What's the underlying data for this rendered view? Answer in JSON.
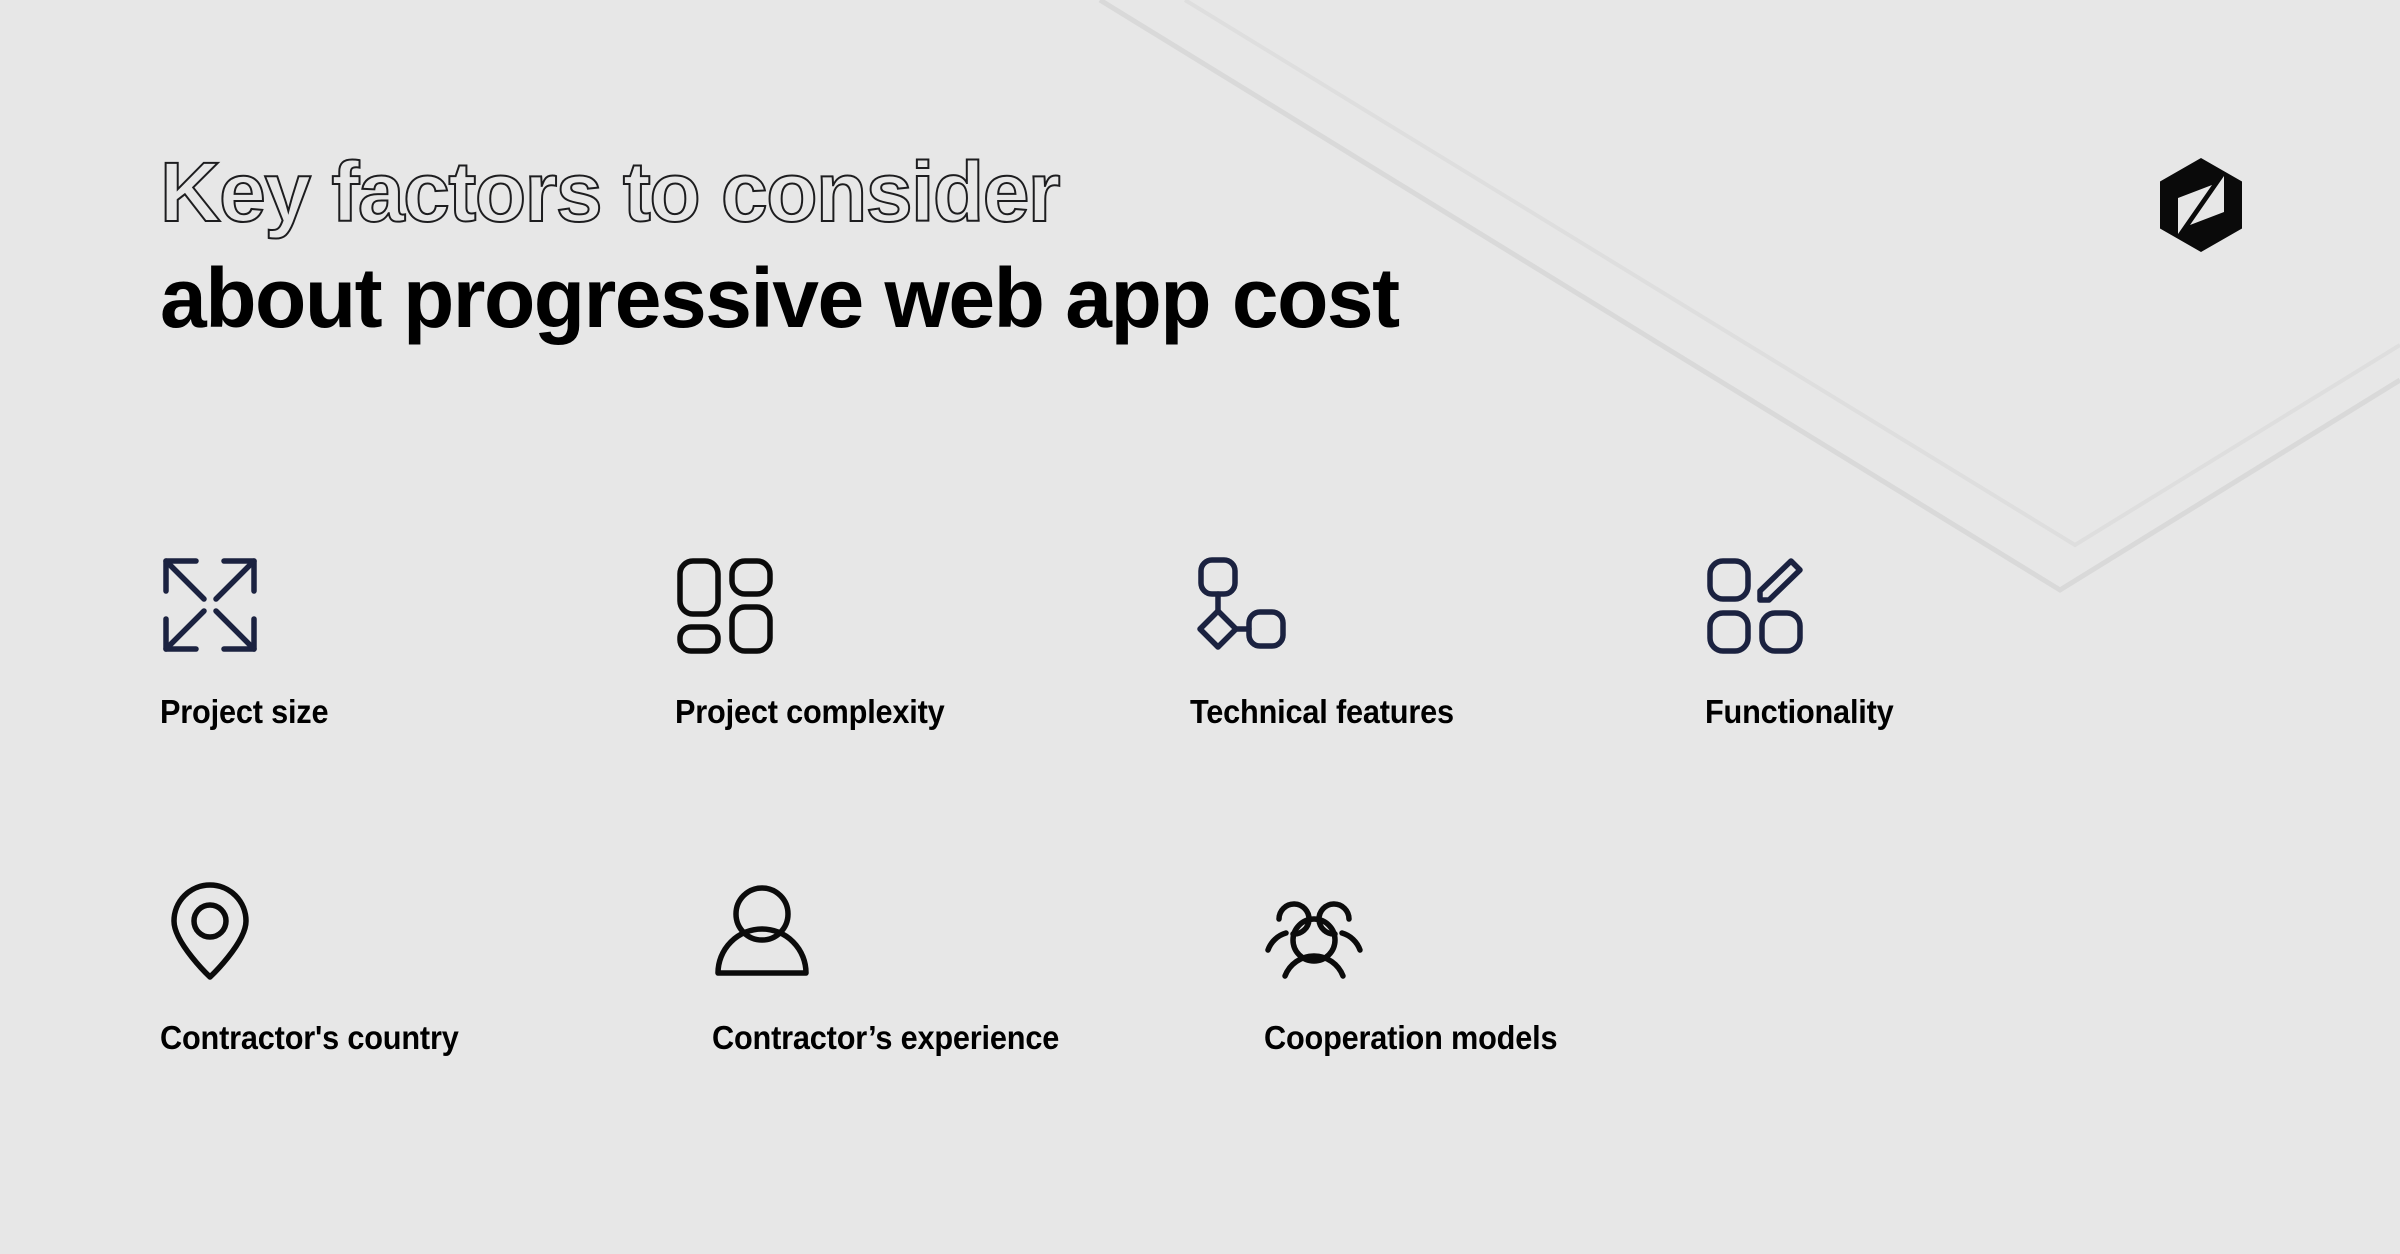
{
  "theme": {
    "background": "#e7e7e7",
    "text": "#000000",
    "icon_navy": "#1b2240",
    "icon_black": "#000000",
    "line_grey": "#d9d9d9"
  },
  "brand": {
    "logo_icon": "hexagon-bolt-logo",
    "logo_color": "#0a0a0a"
  },
  "heading": {
    "line1": "Key factors to consider",
    "line2": "about progressive web app cost"
  },
  "factors": {
    "rows": [
      {
        "items": [
          {
            "icon": "expand-arrows-icon",
            "label": "Project size",
            "icon_color": "#1b2240"
          },
          {
            "icon": "layout-blocks-icon",
            "label": "Project complexity",
            "icon_color": "#0b0b0b"
          },
          {
            "icon": "node-graph-icon",
            "label": "Technical features",
            "icon_color": "#1b2240"
          },
          {
            "icon": "blocks-pencil-icon",
            "label": "Functionality",
            "icon_color": "#1b2240"
          }
        ]
      },
      {
        "items": [
          {
            "icon": "map-pin-icon",
            "label": "Contractor's country",
            "icon_color": "#0b0b0b"
          },
          {
            "icon": "user-icon",
            "label": "Contractor’s experience",
            "icon_color": "#0b0b0b"
          },
          {
            "icon": "users-group-icon",
            "label": "Cooperation models",
            "icon_color": "#0b0b0b"
          }
        ]
      }
    ]
  },
  "decoration": {
    "chevron_label": "background-chevron-lines"
  }
}
